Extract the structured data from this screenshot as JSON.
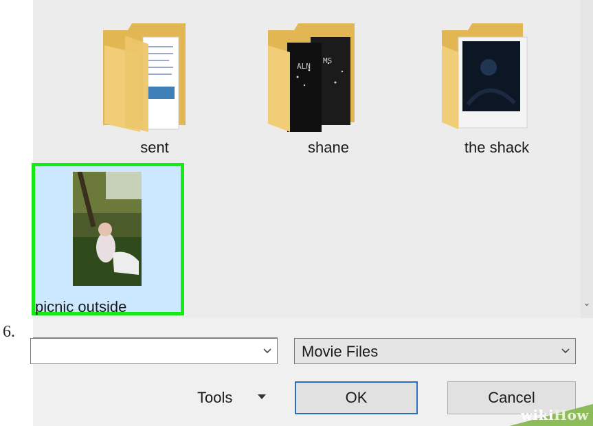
{
  "step_number": "6.",
  "folders": [
    {
      "label": "sent",
      "icon": "folder-documents-icon"
    },
    {
      "label": "shane",
      "icon": "folder-posters-icon"
    },
    {
      "label": "the shack",
      "icon": "folder-dark-photo-icon"
    }
  ],
  "selected_file": {
    "label": "picnic outside",
    "icon": "photo-thumbnail-icon"
  },
  "filename_combo": {
    "value": ""
  },
  "filter_combo": {
    "value": "Movie Files"
  },
  "buttons": {
    "tools": "Tools",
    "ok": "OK",
    "cancel": "Cancel"
  },
  "watermark": {
    "prefix": "wiki",
    "suffix": "How"
  },
  "colors": {
    "selection_border": "#17e817",
    "selection_fill": "#cce8ff",
    "ok_border": "#2b6dbf",
    "folder": "#e8c46a"
  }
}
